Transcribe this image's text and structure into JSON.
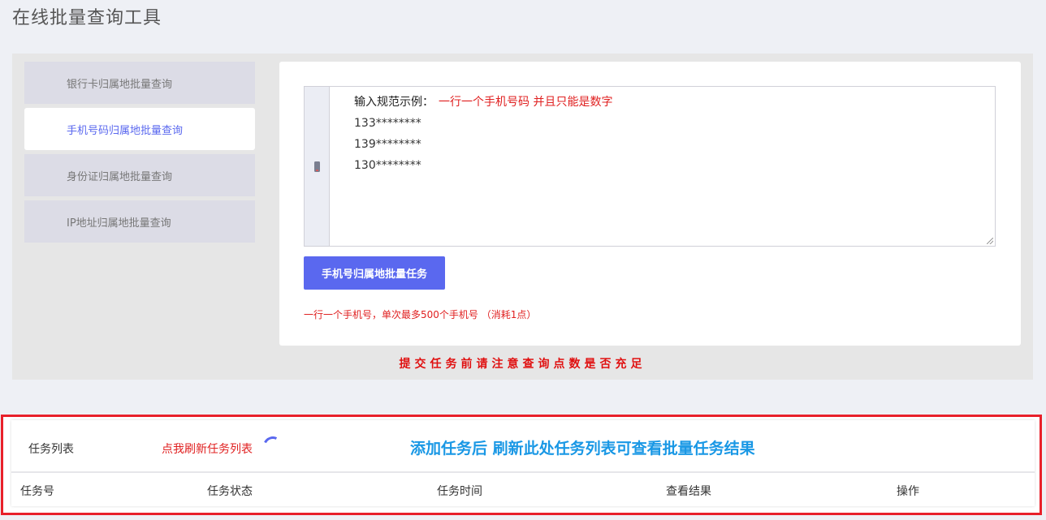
{
  "page": {
    "title": "在线批量查询工具"
  },
  "sidebar": {
    "items": [
      {
        "label": "银行卡归属地批量查询",
        "active": false
      },
      {
        "label": "手机号码归属地批量查询",
        "active": true
      },
      {
        "label": "身份证归属地批量查询",
        "active": false
      },
      {
        "label": "IP地址归属地批量查询",
        "active": false
      }
    ]
  },
  "form": {
    "input_icon": "phone-icon",
    "hint_label": "输入规范示例：",
    "hint_rule": "一行一个手机号码 并且只能是数字",
    "examples": [
      "133********",
      "139********",
      "130********"
    ],
    "submit_label": "手机号归属地批量任务",
    "note": "一行一个手机号，单次最多500个手机号 （消耗1点）"
  },
  "warning": "提交任务前请注意查询点数是否充足",
  "task_list": {
    "title": "任务列表",
    "refresh_label": "点我刷新任务列表",
    "tip": "添加任务后 刷新此处任务列表可查看批量任务结果",
    "columns": [
      "任务号",
      "任务状态",
      "任务时间",
      "查看结果",
      "操作"
    ]
  },
  "colors": {
    "accent": "#5a68ef",
    "warning_red": "#e02020",
    "tip_blue": "#1a98e5",
    "highlight_border": "#e8202a"
  }
}
